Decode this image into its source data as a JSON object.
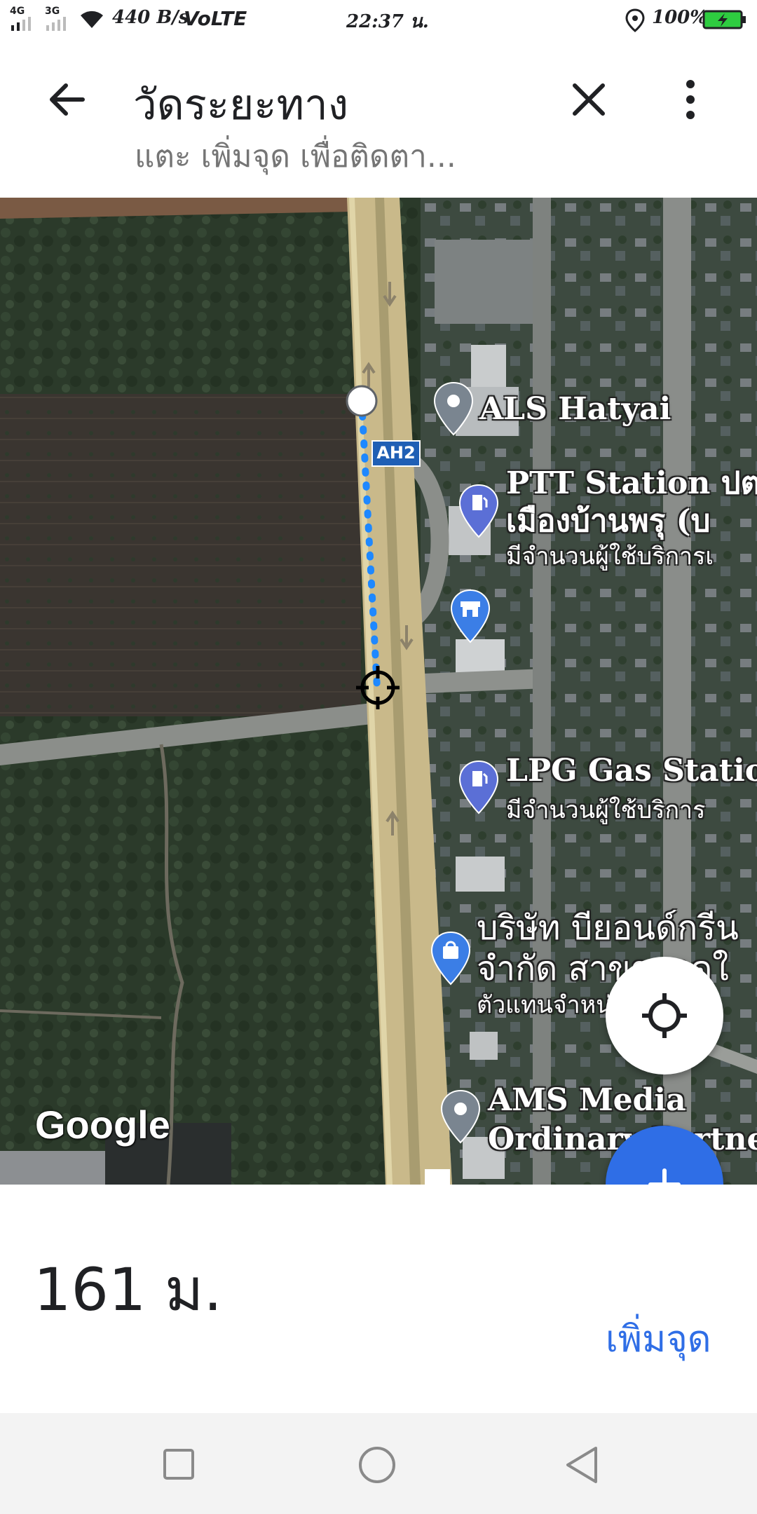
{
  "status_bar": {
    "network_1": "4G",
    "network_2": "3G",
    "speed": "440 B/s",
    "volte": "VoLTE",
    "time": "22:37 น.",
    "battery": "100%"
  },
  "header": {
    "title": "วัดระยะทาง",
    "subtitle": "แตะ เพิ่มจุด เพื่อติดตา..."
  },
  "map": {
    "road_shield": "AH2",
    "places": [
      {
        "name": "ALS Hatyai",
        "subtitle": ""
      },
      {
        "name": "PTT Station ปตท",
        "line2": "เมืองบ้านพรุ (บ",
        "subtitle": "มีจำนวนผู้ใช้บริการเ"
      },
      {
        "name": "LPG Gas Station",
        "subtitle": "มีจำนวนผู้ใช้บริการ"
      },
      {
        "name": "บริษัท บียอนด์กรีน",
        "line2": "จำกัด สาขาหาดใ",
        "subtitle": "ตัวแทนจำหน่ายรถยนต์"
      },
      {
        "name": "AMS Media",
        "line2": "Ordinary Partnership",
        "subtitle": ""
      }
    ],
    "attribution": "Google"
  },
  "panel": {
    "distance": "161 ม.",
    "add_point_label": "เพิ่มจุด"
  },
  "colors": {
    "accent": "#2f6ee6",
    "route": "#1e88ff",
    "pin": "#5b8dd6"
  }
}
